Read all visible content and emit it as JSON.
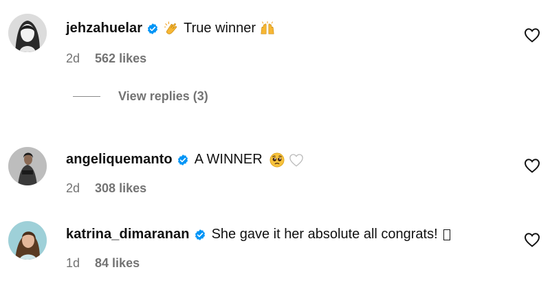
{
  "comments": [
    {
      "username": "jehzahuelar",
      "pre_emoji": "clapping-hands-emoji",
      "text": "True winner",
      "post_emoji": "raising-hands-emoji",
      "age": "2d",
      "likes": "562 likes",
      "view_replies": "View replies (3)"
    },
    {
      "username": "angeliquemanto",
      "text": "A WINNER",
      "post_emoji": "pleading-face-emoji",
      "post_emoji_2": "white-heart-emoji",
      "age": "2d",
      "likes": "308 likes"
    },
    {
      "username": "katrina_dimaranan",
      "text": "She gave it her absolute all congrats!",
      "trailing_glyph": "missing-glyph-box",
      "age": "1d",
      "likes": "84 likes"
    }
  ],
  "icons": {
    "verified": "verified-badge-icon",
    "like": "heart-outline-icon"
  },
  "colors": {
    "verified_blue": "#0095f6",
    "meta_gray": "#737373",
    "text": "#111111"
  }
}
